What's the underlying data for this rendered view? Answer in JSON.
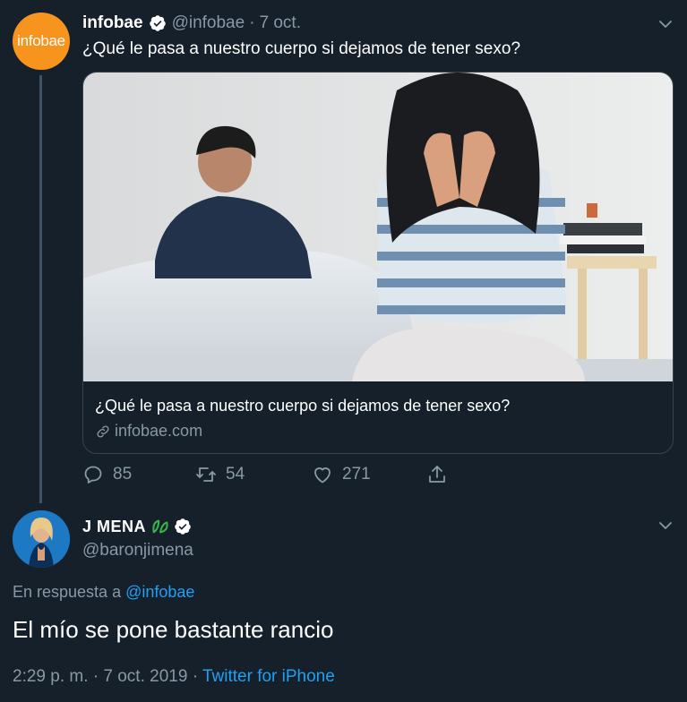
{
  "tweet1": {
    "avatar_text": "infobae",
    "name": "infobae",
    "handle": "@infobae",
    "separator": "·",
    "date": "7 oct.",
    "text": "¿Qué le pasa a nuestro cuerpo si dejamos de tener sexo?",
    "card": {
      "title": "¿Qué le pasa a nuestro cuerpo si dejamos de tener sexo?",
      "domain": "infobae.com"
    },
    "actions": {
      "replies": "85",
      "retweets": "54",
      "likes": "271"
    }
  },
  "tweet2": {
    "name": "J MENA",
    "handle": "@baronjimena",
    "reply_prefix": "En respuesta a",
    "reply_to": "@infobae",
    "text": "El mío se pone bastante rancio",
    "time": "2:29 p. m.",
    "separator1": "·",
    "full_date": "7 oct. 2019",
    "separator2": "·",
    "client": "Twitter for iPhone"
  },
  "colors": {
    "background": "#15202b",
    "muted": "#8899a6",
    "link": "#1da1f2",
    "infobae_orange": "#f7941d",
    "verified": "#ffffff"
  },
  "icons": [
    "verified-icon",
    "chevron-down-icon",
    "reply-icon",
    "retweet-icon",
    "like-icon",
    "share-icon",
    "link-icon",
    "plant-emoji-icon"
  ]
}
